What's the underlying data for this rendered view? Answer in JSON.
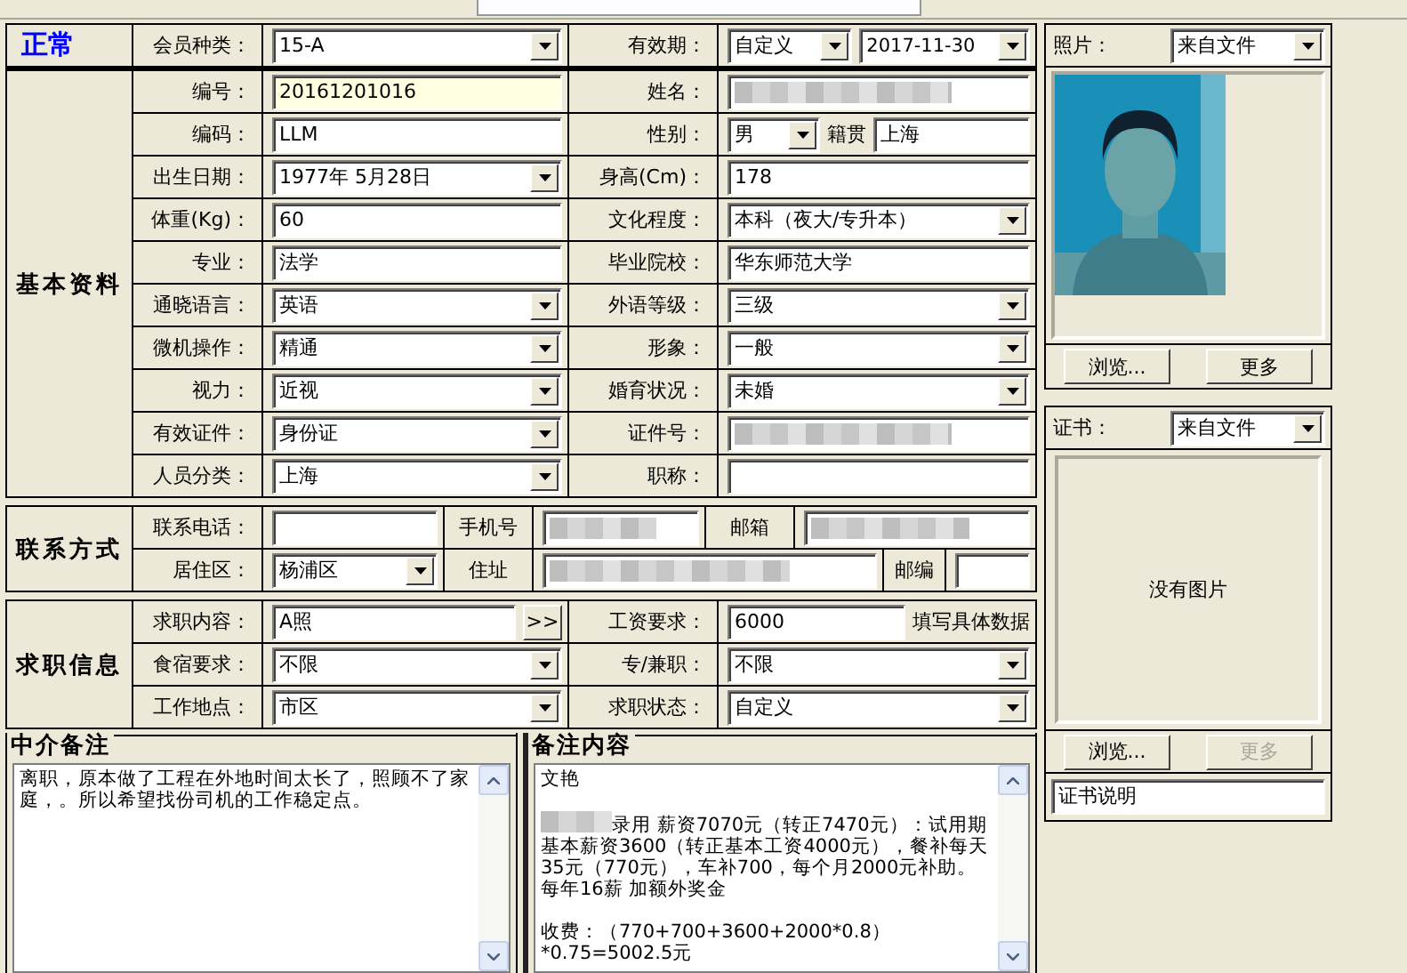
{
  "sections": [
    {
      "title": "正常",
      "kind": "status",
      "rows": [
        [
          {
            "kind": "label",
            "text": "会员种类："
          },
          {
            "kind": "combo",
            "value": "15-A"
          },
          {
            "kind": "label",
            "text": "有效期："
          },
          {
            "kind": "group",
            "items": [
              {
                "kind": "combo",
                "value": "自定义"
              },
              {
                "kind": "combo",
                "value": "2017-11-30"
              }
            ]
          }
        ]
      ]
    },
    {
      "title": "基本资料",
      "kind": "form",
      "rows": [
        [
          {
            "kind": "label",
            "text": "编号："
          },
          {
            "kind": "text",
            "value": "20161201016",
            "highlighted": true
          },
          {
            "kind": "label",
            "text": "姓名："
          },
          {
            "kind": "redacted"
          }
        ],
        [
          {
            "kind": "label",
            "text": "编码："
          },
          {
            "kind": "text",
            "value": "LLM"
          },
          {
            "kind": "label",
            "text": "性别："
          },
          {
            "kind": "group",
            "items": [
              {
                "kind": "combo",
                "value": "男"
              },
              {
                "kind": "caption",
                "text": "籍贯"
              },
              {
                "kind": "text",
                "value": "上海"
              }
            ]
          }
        ],
        [
          {
            "kind": "label",
            "text": "出生日期："
          },
          {
            "kind": "combo",
            "value": "1977年 5月28日"
          },
          {
            "kind": "label",
            "text": "身高(Cm)："
          },
          {
            "kind": "text",
            "value": "178"
          }
        ],
        [
          {
            "kind": "label",
            "text": "体重(Kg)："
          },
          {
            "kind": "text",
            "value": "60"
          },
          {
            "kind": "label",
            "text": "文化程度："
          },
          {
            "kind": "combo",
            "value": "本科（夜大/专升本）"
          }
        ],
        [
          {
            "kind": "label",
            "text": "专业："
          },
          {
            "kind": "text",
            "value": "法学"
          },
          {
            "kind": "label",
            "text": "毕业院校："
          },
          {
            "kind": "text",
            "value": "华东师范大学"
          }
        ],
        [
          {
            "kind": "label",
            "text": "通晓语言："
          },
          {
            "kind": "combo",
            "value": "英语"
          },
          {
            "kind": "label",
            "text": "外语等级："
          },
          {
            "kind": "combo",
            "value": "三级"
          }
        ],
        [
          {
            "kind": "label",
            "text": "微机操作："
          },
          {
            "kind": "combo",
            "value": "精通"
          },
          {
            "kind": "label",
            "text": "形象："
          },
          {
            "kind": "combo",
            "value": "一般"
          }
        ],
        [
          {
            "kind": "label",
            "text": "视力："
          },
          {
            "kind": "combo",
            "value": "近视"
          },
          {
            "kind": "label",
            "text": "婚育状况："
          },
          {
            "kind": "combo",
            "value": "未婚"
          }
        ],
        [
          {
            "kind": "label",
            "text": "有效证件："
          },
          {
            "kind": "combo",
            "value": "身份证"
          },
          {
            "kind": "label",
            "text": "证件号："
          },
          {
            "kind": "redacted"
          }
        ],
        [
          {
            "kind": "label",
            "text": "人员分类："
          },
          {
            "kind": "combo",
            "value": "上海"
          },
          {
            "kind": "label",
            "text": "职称："
          },
          {
            "kind": "text"
          }
        ]
      ]
    },
    {
      "title": "联系方式",
      "kind": "contact",
      "rows": [
        [
          {
            "kind": "label",
            "text": "联系电话："
          },
          {
            "kind": "text"
          },
          {
            "kind": "label",
            "text": "手机号"
          },
          {
            "kind": "redacted"
          },
          {
            "kind": "label",
            "text": "邮箱"
          },
          {
            "kind": "redacted"
          }
        ],
        [
          {
            "kind": "label",
            "text": "居住区："
          },
          {
            "kind": "combo",
            "value": "杨浦区"
          },
          {
            "kind": "label",
            "text": "住址"
          },
          {
            "kind": "redacted"
          },
          {
            "kind": "label",
            "text": "邮编"
          },
          {
            "kind": "text"
          }
        ]
      ]
    },
    {
      "title": "求职信息",
      "kind": "form",
      "rows": [
        [
          {
            "kind": "label",
            "text": "求职内容："
          },
          {
            "kind": "group",
            "items": [
              {
                "kind": "text",
                "value": "A照"
              },
              {
                "kind": "button",
                "text": ">>"
              }
            ]
          },
          {
            "kind": "label",
            "text": "工资要求："
          },
          {
            "kind": "group",
            "items": [
              {
                "kind": "text",
                "value": "6000"
              },
              {
                "kind": "caption",
                "text": "填写具体数据"
              }
            ]
          }
        ],
        [
          {
            "kind": "label",
            "text": "食宿要求："
          },
          {
            "kind": "combo",
            "value": "不限"
          },
          {
            "kind": "label",
            "text": "专/兼职："
          },
          {
            "kind": "combo",
            "value": "不限"
          }
        ],
        [
          {
            "kind": "label",
            "text": "工作地点："
          },
          {
            "kind": "combo",
            "value": "市区"
          },
          {
            "kind": "label",
            "text": "求职状态："
          },
          {
            "kind": "combo",
            "value": "自定义"
          }
        ]
      ]
    }
  ],
  "agency_notes": {
    "title": "中介备注",
    "text": "离职，原本做了工程在外地时间太长了，照顾不了家庭，。所以希望找份司机的工作稳定点。"
  },
  "remarks": {
    "title": "备注内容",
    "paragraphs": [
      {
        "lines": [
          "文艳"
        ],
        "redacted_prefix": false
      },
      {
        "lines": [
          "录用 薪资7070元（转正7470元）：试用期基本薪资3600（转正基本工资4000元），餐补每天35元（770元），车补700，每个月2000元补助。",
          "每年16薪 加额外奖金"
        ],
        "redacted_prefix": true
      },
      {
        "lines": [
          "收费：（770+700+3600+2000*0.8）*0.75=5002.5元"
        ],
        "redacted_prefix": false
      }
    ]
  },
  "photo": {
    "label": "照片：",
    "source": "来自文件",
    "buttons": [
      {
        "label": "浏览...",
        "disabled": false
      },
      {
        "label": "更多",
        "disabled": false
      }
    ]
  },
  "certificate": {
    "label": "证书：",
    "source": "来自文件",
    "empty_text": "没有图片",
    "buttons": [
      {
        "label": "浏览...",
        "disabled": false
      },
      {
        "label": "更多",
        "disabled": true
      }
    ],
    "caption_field": "证书说明"
  }
}
